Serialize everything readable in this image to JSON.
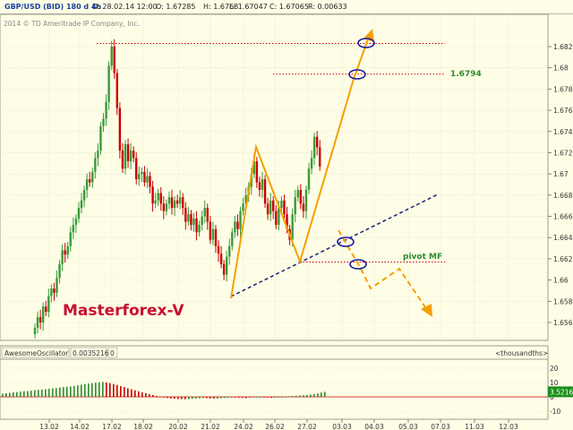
{
  "header": {
    "symbol": "GBP/USD (BID) 180 d 4h",
    "date": "D: 28.02.14 12:00",
    "open": "O: 1.67285",
    "high": "H: 1.6768",
    "low": "L: 1.67047",
    "close": "C: 1.67065",
    "range": "R: 0.00633"
  },
  "copyright": "2014 © TD Ameritrade IP Company, Inc.",
  "watermark": "Masterforex-V",
  "colors": {
    "background": "#fefee6",
    "bull": "#3a9a3a",
    "bear": "#cc0000",
    "orange": "#f5a000",
    "trend": "#1a237e",
    "level": "#cc0000",
    "label_green": "#2e8b2e"
  },
  "chart_data": [
    {
      "type": "candlestick",
      "title": "GBP/USD (BID) 180 d 4h",
      "ylim": [
        1.655,
        1.6855
      ],
      "y_ticks": [
        "1.682",
        "1.68",
        "1.678",
        "1.676",
        "1.674",
        "1.672",
        "1.67",
        "1.668",
        "1.666",
        "1.664",
        "1.662",
        "1.66",
        "1.658",
        "1.656"
      ],
      "x_ticks": [
        "13.02",
        "14.02",
        "17.02",
        "18.02",
        "20.02",
        "21.02",
        "24.02",
        "26.02",
        "27.02",
        "03.03",
        "04.03",
        "05.03",
        "07.03",
        "11.03",
        "12.03"
      ],
      "annotations": [
        {
          "label": "1.6794",
          "price": 1.6794
        },
        {
          "label": "pivot MF",
          "price": 1.6617
        }
      ],
      "levels": [
        1.6823,
        1.6794,
        1.6617
      ],
      "candle_closes": [
        1.6555,
        1.6565,
        1.656,
        1.6575,
        1.657,
        1.6585,
        1.6592,
        1.6588,
        1.6602,
        1.6615,
        1.6628,
        1.6624,
        1.6632,
        1.6645,
        1.6652,
        1.6658,
        1.6668,
        1.6675,
        1.6685,
        1.6695,
        1.6692,
        1.6702,
        1.6715,
        1.6722,
        1.6745,
        1.6752,
        1.6768,
        1.6802,
        1.682,
        1.6795,
        1.6762,
        1.6722,
        1.6705,
        1.6728,
        1.6712,
        1.6722,
        1.6715,
        1.6695,
        1.67,
        1.6702,
        1.6692,
        1.6698,
        1.6688,
        1.6672,
        1.6675,
        1.6682,
        1.6672,
        1.6665,
        1.6672,
        1.6678,
        1.6668,
        1.6675,
        1.6672,
        1.6678,
        1.6668,
        1.6655,
        1.6662,
        1.6652,
        1.6658,
        1.6645,
        1.6652,
        1.666,
        1.6668,
        1.6655,
        1.6638,
        1.6648,
        1.6632,
        1.6625,
        1.6615,
        1.6605,
        1.6622,
        1.6632,
        1.6645,
        1.6655,
        1.6648,
        1.6665,
        1.6672,
        1.668,
        1.6688,
        1.67,
        1.6712,
        1.6692,
        1.6685,
        1.6695,
        1.6672,
        1.6662,
        1.6675,
        1.6665,
        1.6652,
        1.6668,
        1.6675,
        1.6662,
        1.6648,
        1.6638,
        1.6662,
        1.6678,
        1.6685,
        1.6672,
        1.6665,
        1.6685,
        1.6705,
        1.6715,
        1.6735,
        1.6725,
        1.6707
      ]
    },
    {
      "type": "bar",
      "title": "AwesomeOscillator",
      "value_label": "0.0035216",
      "value_suffix": "0",
      "unit_label": "<thousandths>",
      "ylim": [
        -10,
        20
      ],
      "y_ticks": [
        "20",
        "10",
        "0",
        "-10"
      ],
      "current_value": "3.52162",
      "values": [
        2.2,
        2.5,
        2.8,
        3.1,
        3.3,
        3.6,
        3.9,
        4.0,
        4.3,
        4.6,
        4.8,
        5.1,
        5.3,
        5.6,
        5.9,
        6.1,
        6.5,
        6.8,
        7.0,
        7.2,
        7.6,
        8.0,
        8.5,
        8.9,
        9.3,
        9.6,
        9.9,
        10.2,
        10.4,
        10.1,
        9.6,
        9.0,
        8.3,
        7.5,
        6.8,
        6.0,
        5.3,
        4.6,
        3.9,
        3.2,
        2.6,
        1.9,
        1.3,
        0.7,
        0.1,
        -0.4,
        -0.8,
        -1.1,
        -1.3,
        -1.5,
        -1.6,
        -1.7,
        -1.6,
        -1.4,
        -1.2,
        -1.0,
        -0.8,
        -0.9,
        -1.1,
        -1.3,
        -1.2,
        -1.0,
        -0.7,
        -0.5,
        -0.3,
        -0.4,
        -0.6,
        -0.8,
        -0.9,
        -0.7,
        -0.5,
        -0.3,
        -0.2,
        -0.3,
        -0.5,
        -0.7,
        -0.6,
        -0.4,
        -0.2,
        0.1,
        0.4,
        0.6,
        0.8,
        1.0,
        1.1,
        1.3,
        1.6,
        2.0,
        2.4,
        3.0,
        3.5
      ]
    }
  ]
}
